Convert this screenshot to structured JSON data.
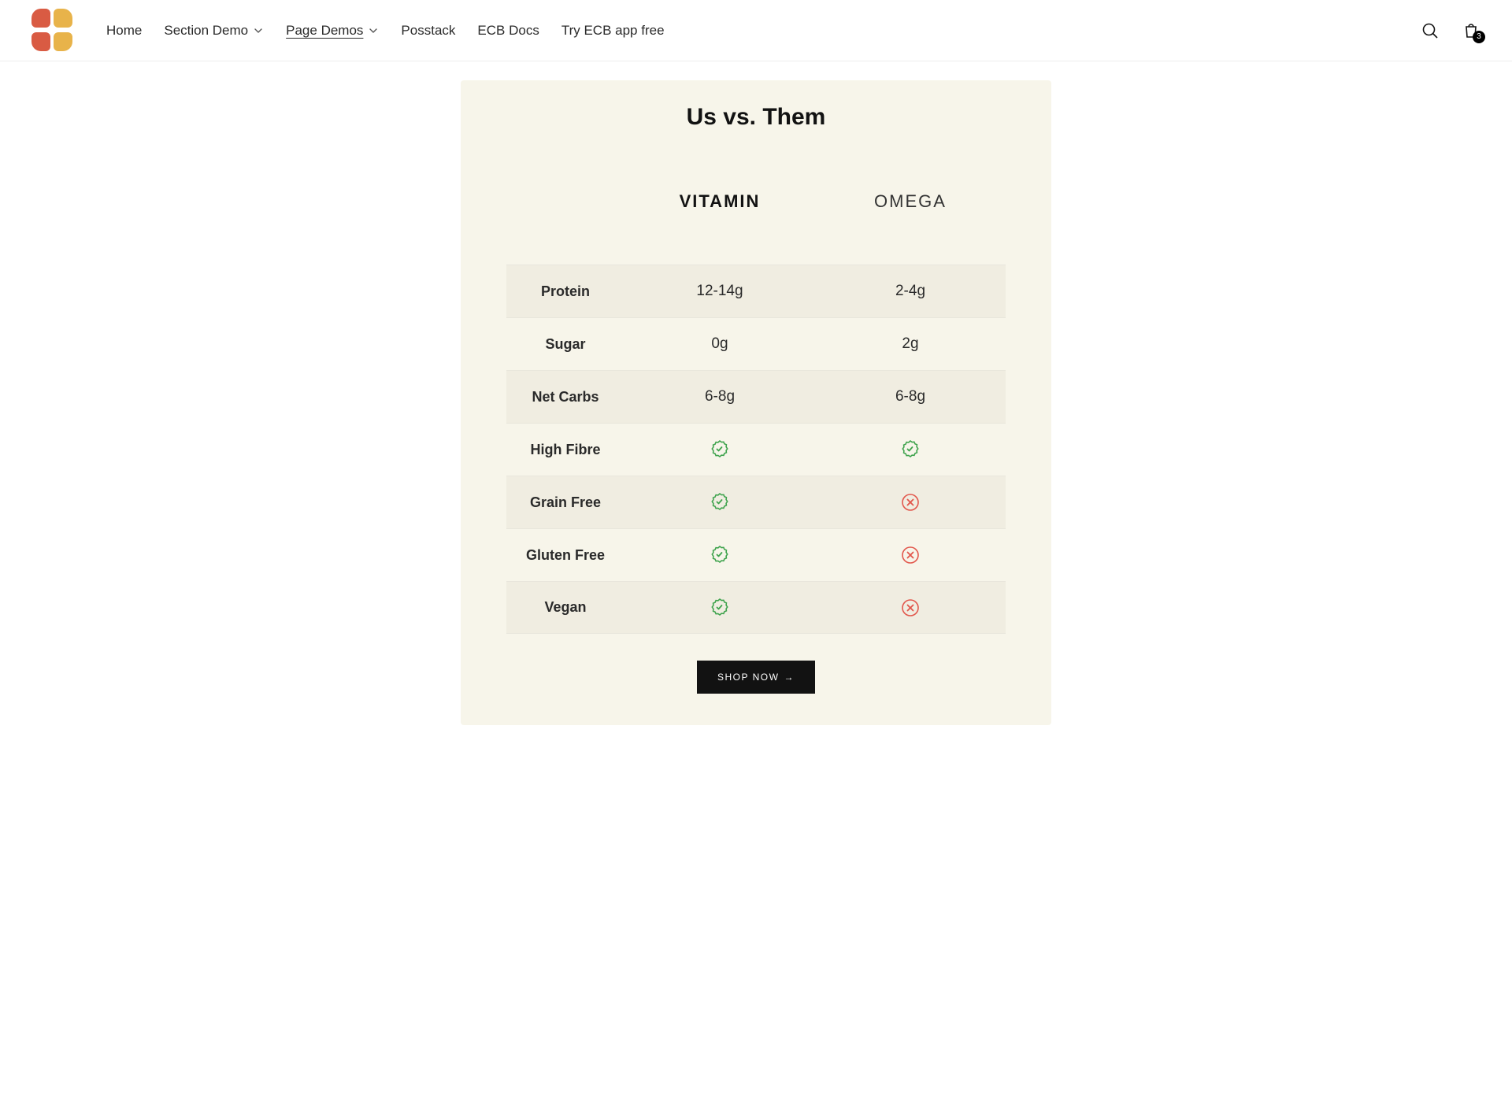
{
  "nav": {
    "items": [
      {
        "label": "Home",
        "dropdown": false
      },
      {
        "label": "Section Demo",
        "dropdown": true
      },
      {
        "label": "Page Demos",
        "dropdown": true,
        "active": true
      },
      {
        "label": "Posstack",
        "dropdown": false
      },
      {
        "label": "ECB Docs",
        "dropdown": false
      },
      {
        "label": "Try ECB app free",
        "dropdown": false
      }
    ]
  },
  "cart": {
    "count": "3"
  },
  "comparison": {
    "title": "Us vs. Them",
    "brands": {
      "a": "VITAMIN",
      "b": "OMEGA"
    },
    "rows": [
      {
        "label": "Protein",
        "a": "12-14g",
        "b": "2-4g"
      },
      {
        "label": "Sugar",
        "a": "0g",
        "b": "2g"
      },
      {
        "label": "Net Carbs",
        "a": "6-8g",
        "b": "6-8g"
      },
      {
        "label": "High Fibre",
        "a": "check",
        "b": "check"
      },
      {
        "label": "Grain Free",
        "a": "check",
        "b": "cross"
      },
      {
        "label": "Gluten Free",
        "a": "check",
        "b": "cross"
      },
      {
        "label": "Vegan",
        "a": "check",
        "b": "cross"
      }
    ],
    "cta": "SHOP NOW"
  }
}
